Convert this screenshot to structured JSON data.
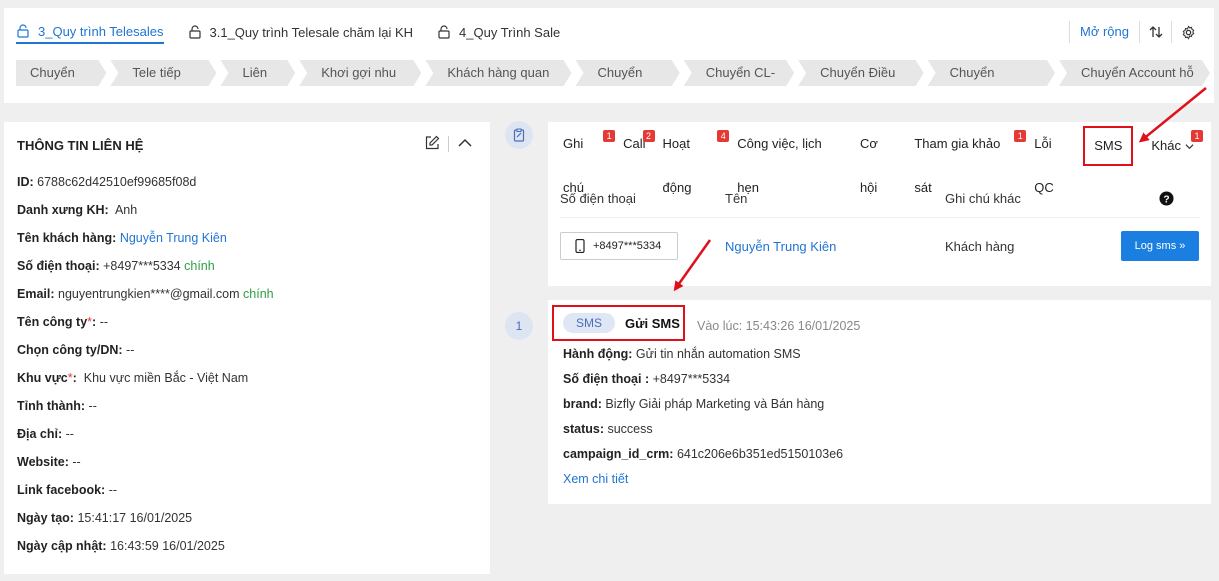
{
  "pipelines": [
    {
      "label": "3_Quy trình Telesales",
      "active": true
    },
    {
      "label": "3.1_Quy trình Telesale chăm lại KH",
      "active": false
    },
    {
      "label": "4_Quy Trình Sale",
      "active": false
    }
  ],
  "toolbar": {
    "expand_label": "Mở rộng"
  },
  "stages": [
    "Chuyển Tele",
    "Tele tiếp nhận",
    "Liên lạc",
    "Khơi gợi nhu cầu",
    "Khách hàng quan tâm",
    "Chuyển sales",
    "Chuyển CL-Fill",
    "Chuyển Điều phối",
    "Chuyển Marketing",
    "Chuyển Account hỗ trợ"
  ],
  "contact": {
    "title": "THÔNG TIN LIÊN HỆ",
    "id_label": "ID:",
    "id_value": "6788c62d42510ef99685f08d",
    "salutation_label": "Danh xưng KH:",
    "salutation_value": "Anh",
    "name_label": "Tên khách hàng:",
    "name_value": "Nguyễn Trung Kiên",
    "phone_label": "Số điện thoại:",
    "phone_value": "+8497***5334",
    "phone_tag": "chính",
    "email_label": "Email:",
    "email_value": "nguyentrungkien****@gmail.com",
    "email_tag": "chính",
    "company_label": "Tên công ty",
    "company_value": "--",
    "choose_company_label": "Chọn công ty/DN:",
    "choose_company_value": "--",
    "region_label": "Khu vực",
    "region_value": "Khu vực miền Bắc - Việt Nam",
    "province_label": "Tỉnh thành:",
    "province_value": "--",
    "address_label": "Địa chỉ:",
    "address_value": "--",
    "website_label": "Website:",
    "website_value": "--",
    "facebook_label": "Link facebook:",
    "facebook_value": "--",
    "created_label": "Ngày tạo:",
    "created_value": "15:41:17 16/01/2025",
    "updated_label": "Ngày cập nhật:",
    "updated_value": "16:43:59 16/01/2025"
  },
  "tabs": [
    {
      "label": "Ghi chú",
      "badge": "1"
    },
    {
      "label": "Call",
      "badge": "2"
    },
    {
      "label": "Hoạt động",
      "badge": "4"
    },
    {
      "label": "Công việc, lịch hẹn",
      "badge": ""
    },
    {
      "label": "Cơ hội",
      "badge": ""
    },
    {
      "label": "Tham gia khảo sát",
      "badge": "1"
    },
    {
      "label": "Lỗi QC",
      "badge": ""
    },
    {
      "label": "SMS",
      "badge": ""
    },
    {
      "label": "Khác",
      "badge": "1"
    }
  ],
  "sms_table": {
    "headers": [
      "Số điện thoại",
      "Tên",
      "Ghi chú khác"
    ],
    "phone": "+8497***5334",
    "name": "Nguyễn Trung Kiên",
    "note": "Khách hàng",
    "log_button": "Log sms »"
  },
  "timeline": {
    "index": "1",
    "pill": "SMS",
    "title": "Gửi SMS",
    "time": "Vào lúc: 15:43:26 16/01/2025",
    "action_label": "Hành động:",
    "action_value": "Gửi tin nhắn automation SMS",
    "phone_label": "Số điện thoại :",
    "phone_value": "+8497***5334",
    "brand_label": "brand:",
    "brand_value": "Bizfly Giải pháp Marketing và Bán hàng",
    "status_label": "status:",
    "status_value": "success",
    "campaign_label": "campaign_id_crm:",
    "campaign_value": "641c206e6b351ed5150103e6",
    "detail_link": "Xem chi tiết"
  },
  "colors": {
    "accent": "#1f74d4",
    "highlight": "#e0101a",
    "badge": "#e53935",
    "tag_green": "#2e9e44"
  }
}
